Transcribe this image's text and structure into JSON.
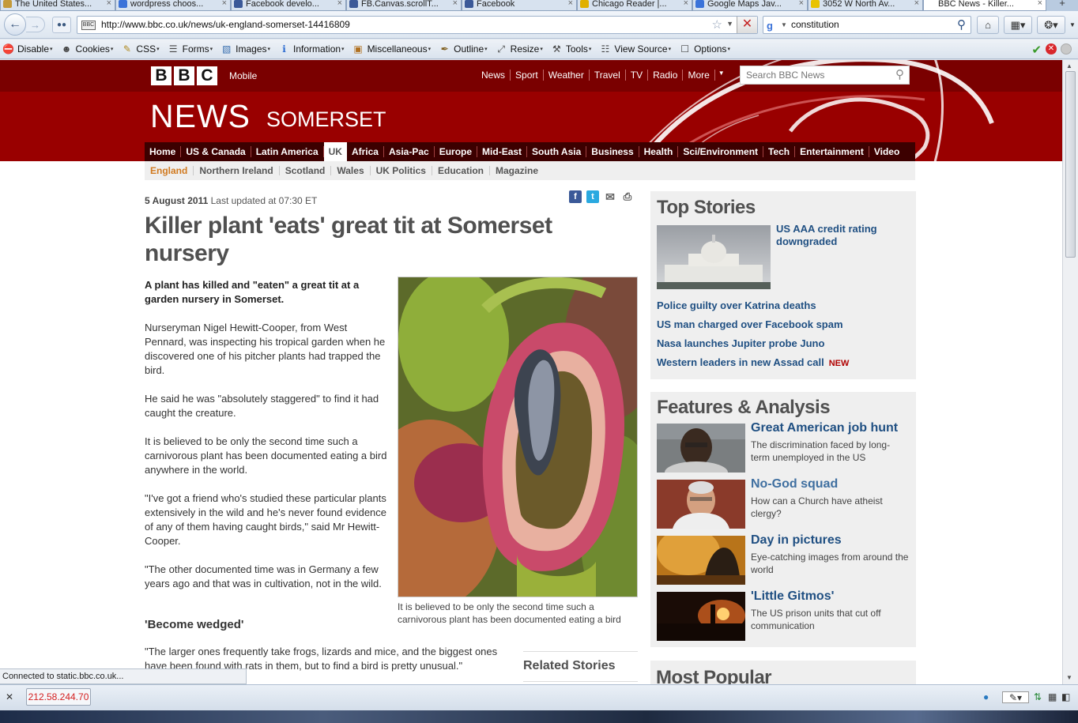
{
  "browser": {
    "tabs": [
      {
        "title": "The United States...",
        "icon_color": "#c49a3a"
      },
      {
        "title": "wordpress choos...",
        "icon_color": "#3b73d9"
      },
      {
        "title": "Facebook develo...",
        "icon_color": "#3b5998"
      },
      {
        "title": "FB.Canvas.scrollT...",
        "icon_color": "#3b5998"
      },
      {
        "title": "Facebook",
        "icon_color": "#3b5998"
      },
      {
        "title": "Chicago Reader |...",
        "icon_color": "#e0b000"
      },
      {
        "title": "Google Maps Jav...",
        "icon_color": "#3b73d9"
      },
      {
        "title": "3052 W North Av...",
        "icon_color": "#e8c300"
      },
      {
        "title": "BBC News - Killer...",
        "icon_color": "#ffffff",
        "active": true
      }
    ],
    "new_tab_symbol": "+",
    "url": "http://www.bbc.co.uk/news/uk-england-somerset-14416809",
    "site_identity_label": "BBC",
    "search_engine_icon": "google-icon",
    "search_value": "constitution",
    "dev_toolbar": [
      {
        "label": "Disable",
        "icon": "no-entry-icon"
      },
      {
        "label": "Cookies",
        "icon": "person-icon"
      },
      {
        "label": "CSS",
        "icon": "pencil-icon"
      },
      {
        "label": "Forms",
        "icon": "form-icon"
      },
      {
        "label": "Images",
        "icon": "image-icon"
      },
      {
        "label": "Information",
        "icon": "info-icon"
      },
      {
        "label": "Miscellaneous",
        "icon": "toolbox-icon"
      },
      {
        "label": "Outline",
        "icon": "pen-icon"
      },
      {
        "label": "Resize",
        "icon": "resize-icon"
      },
      {
        "label": "Tools",
        "icon": "tools-icon"
      },
      {
        "label": "View Source",
        "icon": "document-icon"
      },
      {
        "label": "Options",
        "icon": "options-icon"
      }
    ],
    "status_text": "Connected to static.bbc.co.uk...",
    "ip_address": "212.58.244.70"
  },
  "site": {
    "logo_letters": [
      "B",
      "B",
      "C"
    ],
    "mobile_label": "Mobile",
    "top_nav": [
      "News",
      "Sport",
      "Weather",
      "Travel",
      "TV",
      "Radio",
      "More"
    ],
    "search_placeholder": "Search BBC News",
    "section_title": "NEWS",
    "region_title": "SOMERSET",
    "main_nav": [
      "Home",
      "US & Canada",
      "Latin America",
      "UK",
      "Africa",
      "Asia-Pac",
      "Europe",
      "Mid-East",
      "South Asia",
      "Business",
      "Health",
      "Sci/Environment",
      "Tech",
      "Entertainment",
      "Video"
    ],
    "main_nav_active": "UK",
    "sub_nav": [
      "England",
      "Northern Ireland",
      "Scotland",
      "Wales",
      "UK Politics",
      "Education",
      "Magazine"
    ],
    "sub_nav_active": "England",
    "brand_red": "#990000"
  },
  "article": {
    "date": "5 August 2011",
    "updated": "Last updated at 07:30 ET",
    "headline": "Killer plant 'eats' great tit at Somerset nursery",
    "intro": "A plant has killed and \"eaten\" a great tit at a garden nursery in Somerset.",
    "paragraphs": [
      "Nurseryman Nigel Hewitt-Cooper, from West Pennard, was inspecting his tropical garden when he discovered one of his pitcher plants had trapped the bird.",
      "He said he was \"absolutely staggered\" to find it had caught the creature.",
      "It is believed to be only the second time such a carnivorous plant has been documented eating a bird anywhere in the world.",
      "\"I've got a friend who's studied these particular plants extensively in the wild and he's never found evidence of any of them having caught birds,\" said Mr Hewitt-Cooper.",
      "\"The other documented time was in Germany a few years ago and that was in cultivation, not in the wild."
    ],
    "crosshead": "'Become wedged'",
    "after_crosshead": "\"The larger ones frequently take frogs, lizards and mice, and the biggest ones have been found with rats in them, but to find a bird is pretty unusual.\"",
    "image_caption": "It is believed to be only the second time such a carnivorous plant has been documented eating a bird",
    "related_title": "Related Stories"
  },
  "sidebar": {
    "top_stories_title": "Top Stories",
    "lead_story": "US AAA credit rating downgraded",
    "stories": [
      {
        "title": "Police guilty over Katrina deaths"
      },
      {
        "title": "US man charged over Facebook spam"
      },
      {
        "title": "Nasa launches Jupiter probe Juno"
      },
      {
        "title": "Western leaders in new Assad call",
        "badge": "NEW"
      }
    ],
    "features_title": "Features & Analysis",
    "features": [
      {
        "title": "Great American job hunt",
        "desc": "The discrimination faced by long-term unemployed in the US",
        "image": "woman-portrait"
      },
      {
        "title": "No-God squad",
        "desc": "How can a Church have atheist clergy?",
        "image": "man-portrait"
      },
      {
        "title": "Day in pictures",
        "desc": "Eye-catching images from around the world",
        "image": "golden-scene"
      },
      {
        "title": "'Little Gitmos'",
        "desc": "The US prison units that cut off communication",
        "image": "prison-sunset"
      }
    ],
    "most_popular_title": "Most Popular"
  }
}
